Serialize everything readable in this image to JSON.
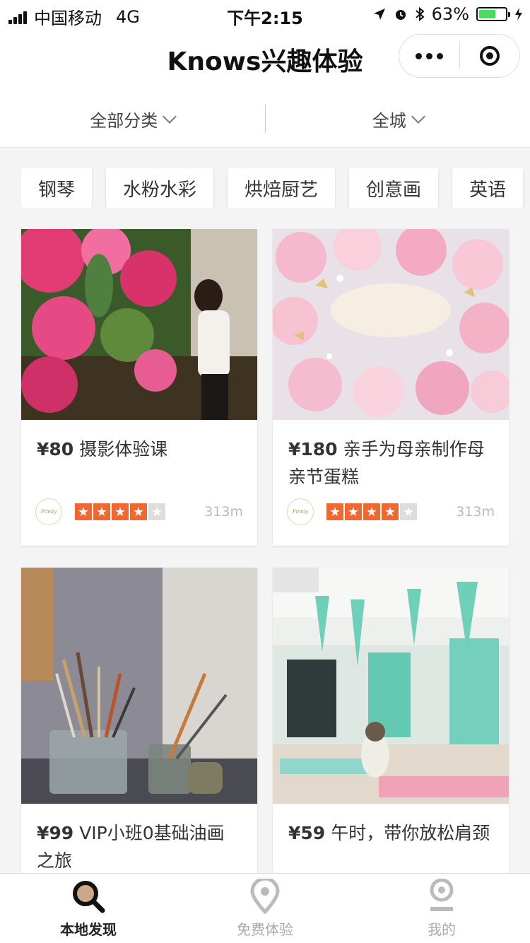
{
  "status_bar": {
    "carrier": "中国移动",
    "network": "4G",
    "time": "下午2:15",
    "battery": "63%",
    "battery_level": 0.63
  },
  "nav": {
    "title": "Knows兴趣体验"
  },
  "filters": [
    {
      "label": "全部分类"
    },
    {
      "label": "全城"
    }
  ],
  "tags": [
    "钢琴",
    "水粉水彩",
    "烘焙厨艺",
    "创意画",
    "英语"
  ],
  "cards": [
    {
      "price": "¥80",
      "title": "摄影体验课",
      "rating": 4,
      "rating_max": 5,
      "distance": "313m",
      "has_meta": true
    },
    {
      "price": "¥180",
      "title": "亲手为母亲制作母亲节蛋糕",
      "rating": 4,
      "rating_max": 5,
      "distance": "313m",
      "has_meta": true
    },
    {
      "price": "¥99",
      "title": "VIP小班0基础油画之旅",
      "has_meta": false
    },
    {
      "price": "¥59",
      "title": "午时，带你放松肩颈",
      "has_meta": false
    }
  ],
  "tabbar": [
    {
      "label": "本地发现",
      "icon": "search-icon",
      "active": true
    },
    {
      "label": "免费体验",
      "icon": "location-pin-icon",
      "active": false
    },
    {
      "label": "我的",
      "icon": "profile-icon",
      "active": false
    }
  ],
  "colors": {
    "star_on": "#f0672f",
    "star_off": "#dddddd",
    "battery": "#4cd964",
    "tab_active": "#222222",
    "tab_inactive": "#aaaaaa"
  }
}
